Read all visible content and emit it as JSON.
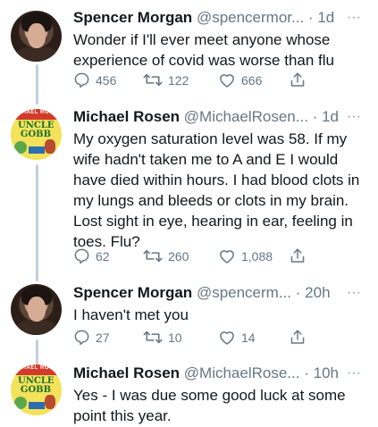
{
  "tweets": [
    {
      "name": "Spencer Morgan",
      "handle": "@spencermor...",
      "separator": "·",
      "time": "1d",
      "more": "···",
      "text": "Wonder if I'll ever meet anyone whose experience of covid was worse than flu",
      "replies": "456",
      "retweets": "122",
      "likes": "666"
    },
    {
      "name": "Michael Rosen",
      "handle": "@MichaelRosen...",
      "separator": "·",
      "time": "1d",
      "more": "···",
      "avatar_author": "MICHAEL ROSEN",
      "avatar_title": "UNCLE GOBB",
      "text": "My oxygen saturation level was 58. If my wife hadn't taken me to A and E I would have died within hours. I had blood clots in my lungs and bleeds or clots in my brain. Lost sight in eye, hearing in ear, feeling in toes. Flu?",
      "replies": "62",
      "retweets": "260",
      "likes": "1,088"
    },
    {
      "name": "Spencer Morgan",
      "handle": "@spencerm...",
      "separator": "·",
      "time": "20h",
      "more": "···",
      "text": "I haven't met you",
      "replies": "27",
      "retweets": "10",
      "likes": "14"
    },
    {
      "name": "Michael Rosen",
      "handle": "@MichaelRose...",
      "separator": "·",
      "time": "10h",
      "more": "···",
      "avatar_author": "MICHAEL ROSEN",
      "avatar_title": "UNCLE GOBB",
      "text": "Yes -  I was due some good luck at some point this year."
    }
  ],
  "colors": {
    "text": "#14171a",
    "muted": "#657786",
    "thread_line": "#c4cfd6"
  },
  "icons": [
    "reply-icon",
    "retweet-icon",
    "like-icon",
    "share-icon",
    "more-icon"
  ]
}
